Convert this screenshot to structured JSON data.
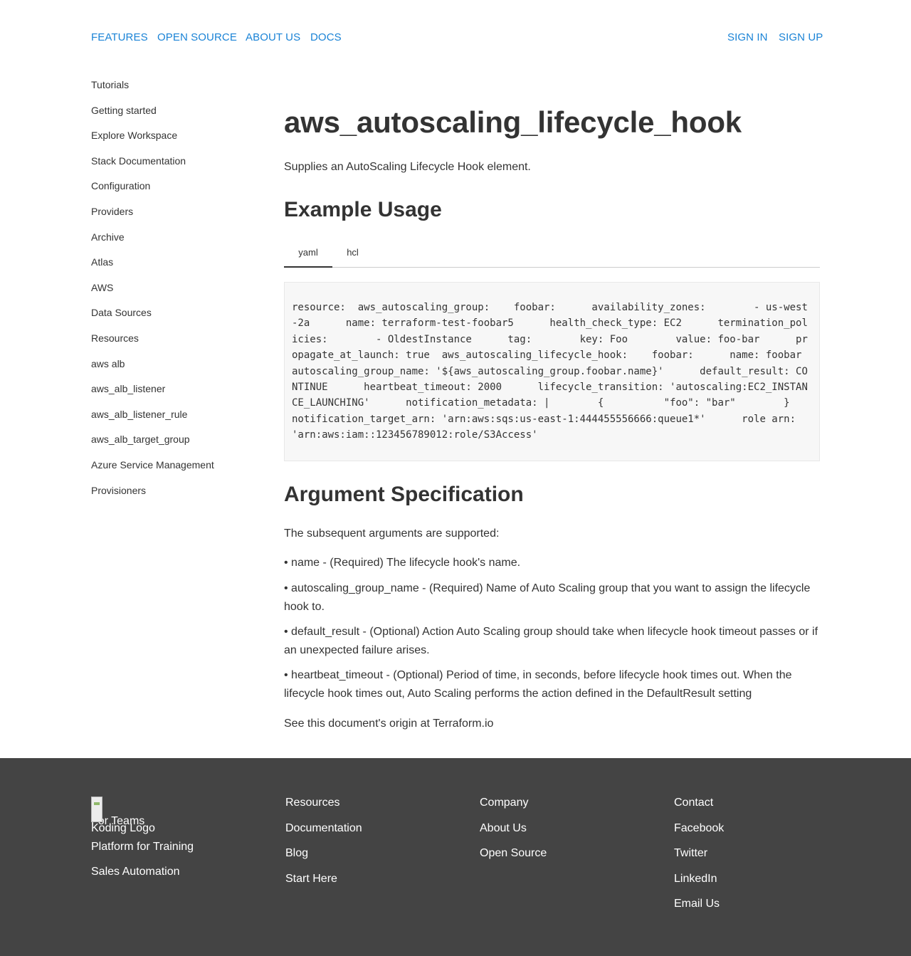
{
  "nav": {
    "left": [
      "FEATURES",
      "OPEN SOURCE",
      "ABOUT US",
      "DOCS"
    ],
    "right": [
      "SIGN IN",
      "SIGN UP"
    ]
  },
  "sidebar": {
    "items": [
      "Tutorials",
      "Getting started",
      "Explore Workspace",
      "Stack Documentation",
      "Configuration",
      "Providers",
      "Archive",
      "Atlas",
      "AWS",
      "Data Sources",
      "Resources",
      "aws alb",
      "aws_alb_listener",
      "aws_alb_listener_rule",
      "aws_alb_target_group",
      "Azure Service Management",
      "Provisioners"
    ]
  },
  "page": {
    "title": "aws_autoscaling_lifecycle_hook",
    "intro": "Supplies an AutoScaling Lifecycle Hook element.",
    "example_heading": "Example Usage",
    "tabs": [
      "yaml",
      "hcl"
    ],
    "active_tab": "yaml",
    "code": "resource:  aws_autoscaling_group:    foobar:      availability_zones:        - us-west-2a      name: terraform-test-foobar5      health_check_type: EC2      termination_policies:        - OldestInstance      tag:        key: Foo        value: foo-bar      propagate_at_launch: true  aws_autoscaling_lifecycle_hook:    foobar:      name: foobar      autoscaling_group_name: '${aws_autoscaling_group.foobar.name}'      default_result: CONTINUE      heartbeat_timeout: 2000      lifecycle_transition: 'autoscaling:EC2_INSTANCE_LAUNCHING'      notification_metadata: |        {          \"foo\": \"bar\"        }      notification_target_arn: 'arn:aws:sqs:us-east-1:444455556666:queue1*'      role arn: 'arn:aws:iam::123456789012:role/S3Access'",
    "args_heading": "Argument Specification",
    "args_intro": "The subsequent arguments are supported:",
    "args": [
      "• name - (Required) The lifecycle hook's name.",
      "• autoscaling_group_name - (Required) Name of Auto Scaling group that you want to assign the lifecycle hook to.",
      "• default_result - (Optional) Action Auto Scaling group should take when lifecycle hook timeout passes or if an unexpected failure arises.",
      "• heartbeat_timeout - (Optional) Period of time, in seconds, before lifecycle hook times out. When the lifecycle hook times out, Auto Scaling performs the action defined in the DefaultResult setting"
    ],
    "origin": "See this document's origin at Terraform.io"
  },
  "footer": {
    "logo_alt": "Koding Logo",
    "col1": [
      "For Teams",
      "Platform for Training",
      "Sales Automation"
    ],
    "col2": [
      "Resources",
      "Documentation",
      "Blog",
      "Start Here"
    ],
    "col3": [
      "Company",
      "About Us",
      "Open Source"
    ],
    "col4": [
      "Contact",
      "Facebook",
      "Twitter",
      "LinkedIn",
      "Email Us"
    ]
  },
  "colors": {
    "link": "#1a83d6",
    "text": "#333333",
    "footer_bg": "#444444",
    "code_bg": "#f7f7f7"
  }
}
